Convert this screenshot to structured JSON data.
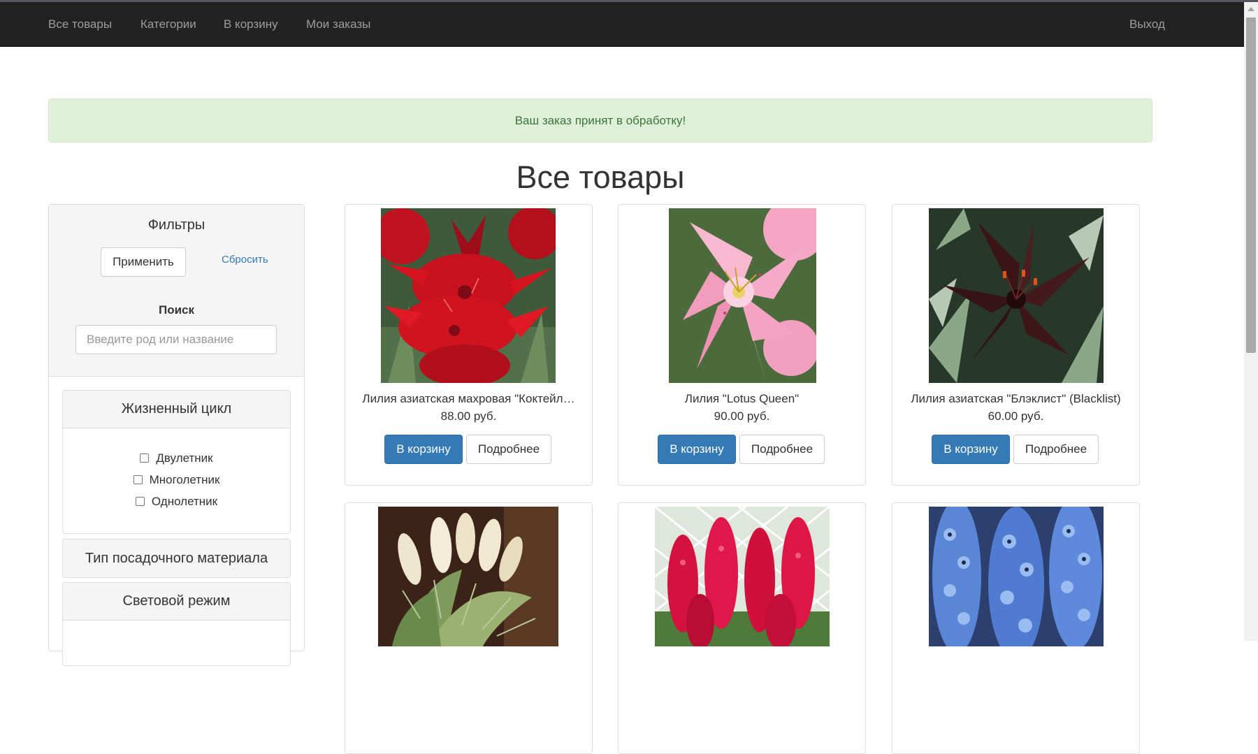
{
  "nav": {
    "items": [
      "Все товары",
      "Категории",
      "В корзину",
      "Мои заказы"
    ],
    "logout": "Выход"
  },
  "alert": {
    "text": "Ваш заказ принят в обработку!"
  },
  "page": {
    "title": "Все товары"
  },
  "filters": {
    "title": "Фильтры",
    "apply_label": "Применить",
    "reset_label": "Сбросить",
    "search_label": "Поиск",
    "search_placeholder": "Введите род или название",
    "search_value": "",
    "groups": [
      {
        "title": "Жизненный цикл",
        "expanded": true,
        "options": [
          "Двулетник",
          "Многолетник",
          "Однолетник"
        ]
      },
      {
        "title": "Тип посадочного материала",
        "expanded": false
      },
      {
        "title": "Световой режим",
        "expanded": true
      }
    ]
  },
  "products": [
    {
      "name": "Лилия азиатская махровая \"Коктейл…",
      "price": "88.00 руб.",
      "cart_label": "В корзину",
      "more_label": "Подробнее",
      "image": "red-double-lily-photo"
    },
    {
      "name": "Лилия \"Lotus Queen\"",
      "price": "90.00 руб.",
      "cart_label": "В корзину",
      "more_label": "Подробнее",
      "image": "pink-lily-photo"
    },
    {
      "name": "Лилия азиатская \"Блэклист\" (Blacklist)",
      "price": "60.00 руб.",
      "cart_label": "В корзину",
      "more_label": "Подробнее",
      "image": "dark-burgundy-lily-photo"
    },
    {
      "image": "pampas-grass-photo"
    },
    {
      "image": "red-lupine-photo"
    },
    {
      "image": "blue-delphinium-photo"
    }
  ]
}
